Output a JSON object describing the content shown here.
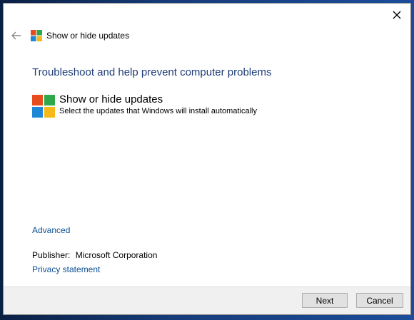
{
  "window": {
    "title": "Show or hide updates"
  },
  "headline": "Troubleshoot and help prevent computer problems",
  "task": {
    "title": "Show or hide updates",
    "description": "Select the updates that Windows will install automatically"
  },
  "links": {
    "advanced": "Advanced",
    "privacy": "Privacy statement"
  },
  "publisher": {
    "label": "Publisher:",
    "value": "Microsoft Corporation"
  },
  "buttons": {
    "next": "Next",
    "cancel": "Cancel"
  },
  "icons": {
    "close": "close-icon",
    "back": "back-arrow-icon",
    "app": "windows-logo-icon"
  },
  "colors": {
    "headline": "#1e3c78",
    "link": "#0b4f95",
    "logo_red": "#e74c1c",
    "logo_green": "#2da84a",
    "logo_blue": "#1e88d6",
    "logo_yellow": "#f8b918"
  }
}
